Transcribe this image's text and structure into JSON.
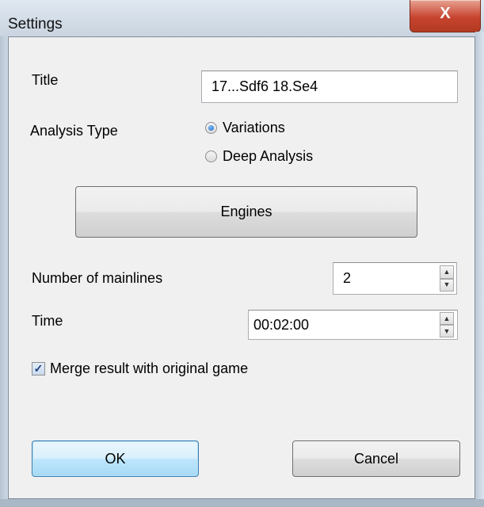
{
  "window": {
    "title": "Settings",
    "close_label": "X"
  },
  "form": {
    "title_label": "Title",
    "title_value": "17...Sdf6 18.Se4",
    "analysis_type_label": "Analysis Type",
    "analysis_options": [
      {
        "label": "Variations",
        "checked": true
      },
      {
        "label": "Deep Analysis",
        "checked": false
      }
    ],
    "engines_label": "Engines",
    "mainlines_label": "Number of mainlines",
    "mainlines_value": "2",
    "time_label": "Time",
    "time_value": "00:02:00",
    "merge_label": "Merge result with original game",
    "merge_checked": true
  },
  "footer": {
    "ok_label": "OK",
    "cancel_label": "Cancel"
  },
  "icons": {
    "spin_up": "▲",
    "spin_down": "▼",
    "checkmark": "✓"
  }
}
